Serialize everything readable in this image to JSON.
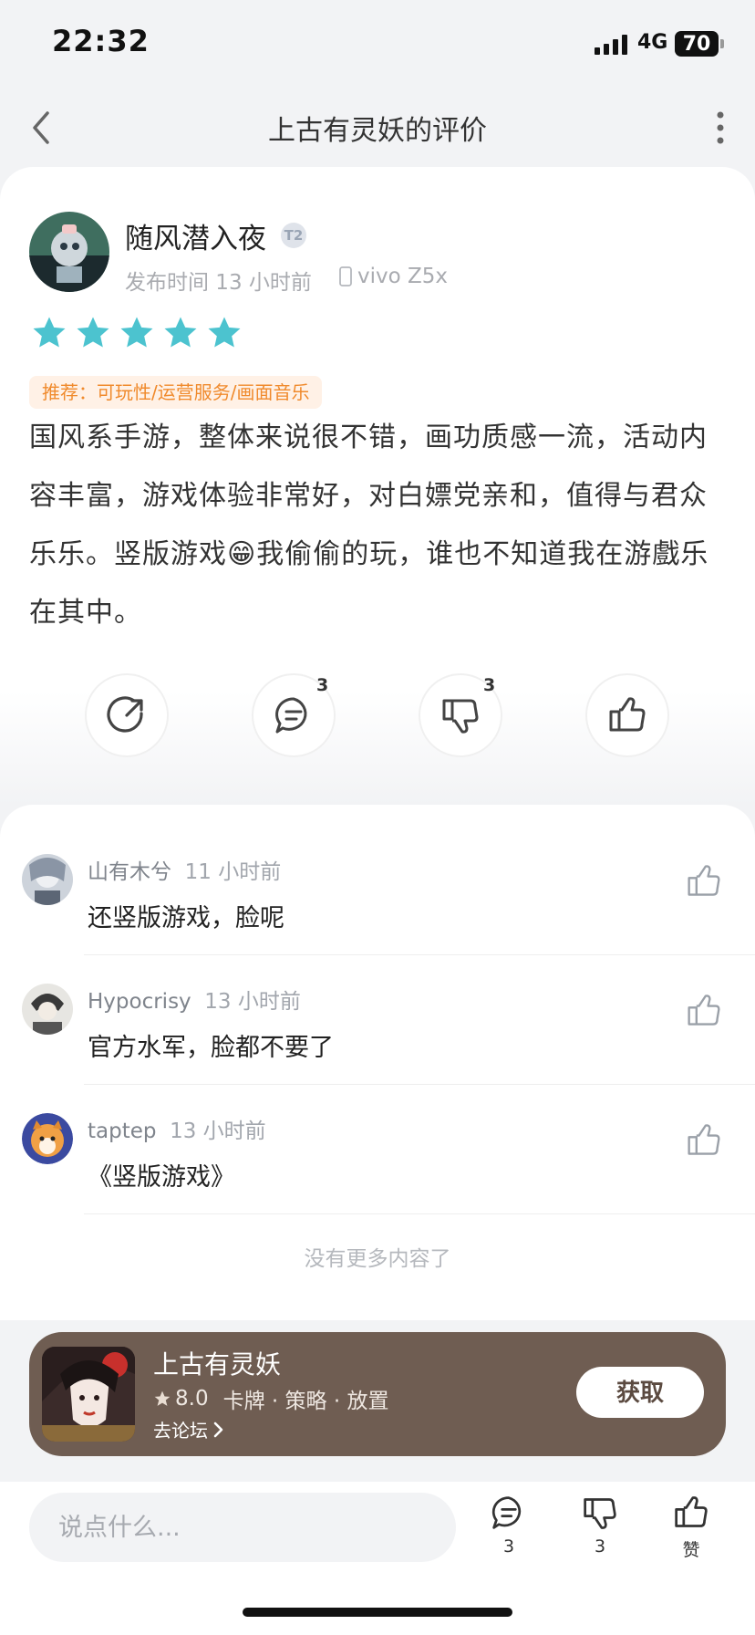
{
  "status_bar": {
    "time": "22:32",
    "network": "4G",
    "battery": "70"
  },
  "nav": {
    "title": "上古有灵妖的评价",
    "back_icon": "chevron-left-icon",
    "more_icon": "more-vertical-icon"
  },
  "review": {
    "user_name": "随风潜入夜",
    "level_badge": "T2",
    "publish_time": "发布时间 13 小时前",
    "device": "vivo Z5x",
    "rating": 5,
    "star_color": "#4cc3cf",
    "tags": "推荐：可玩性/运营服务/画面音乐",
    "text_before_emoji": "国风系手游，整体来说很不错，画功质感一流，活动内容丰富，游戏体验非常好，对白嫖党亲和，值得与君众乐乐。竖版游戏",
    "emoji": "😁",
    "text_after_emoji": "我偷偷的玩，谁也不知道我在游戲乐在其中。",
    "actions": {
      "share_icon": "share-icon",
      "comment_count": "3",
      "dislike_count": "3",
      "like_icon": "thumbs-up-icon"
    }
  },
  "comments": [
    {
      "name": "山有木兮",
      "time": "11 小时前",
      "text": "还竖版游戏，脸呢"
    },
    {
      "name": "Hypocrisy",
      "time": "13 小时前",
      "text": "官方水军，脸都不要了"
    },
    {
      "name": "taptep",
      "time": "13 小时前",
      "text": "《竖版游戏》"
    }
  ],
  "no_more": "没有更多内容了",
  "game": {
    "name": "上古有灵妖",
    "rating": "8.0",
    "genres": "卡牌 · 策略 · 放置",
    "forum_link": "去论坛",
    "get_button": "获取",
    "banner_color": "#6f5d52"
  },
  "bottom_bar": {
    "input_placeholder": "说点什么...",
    "comment_count": "3",
    "dislike_count": "3",
    "like_label": "赞"
  }
}
